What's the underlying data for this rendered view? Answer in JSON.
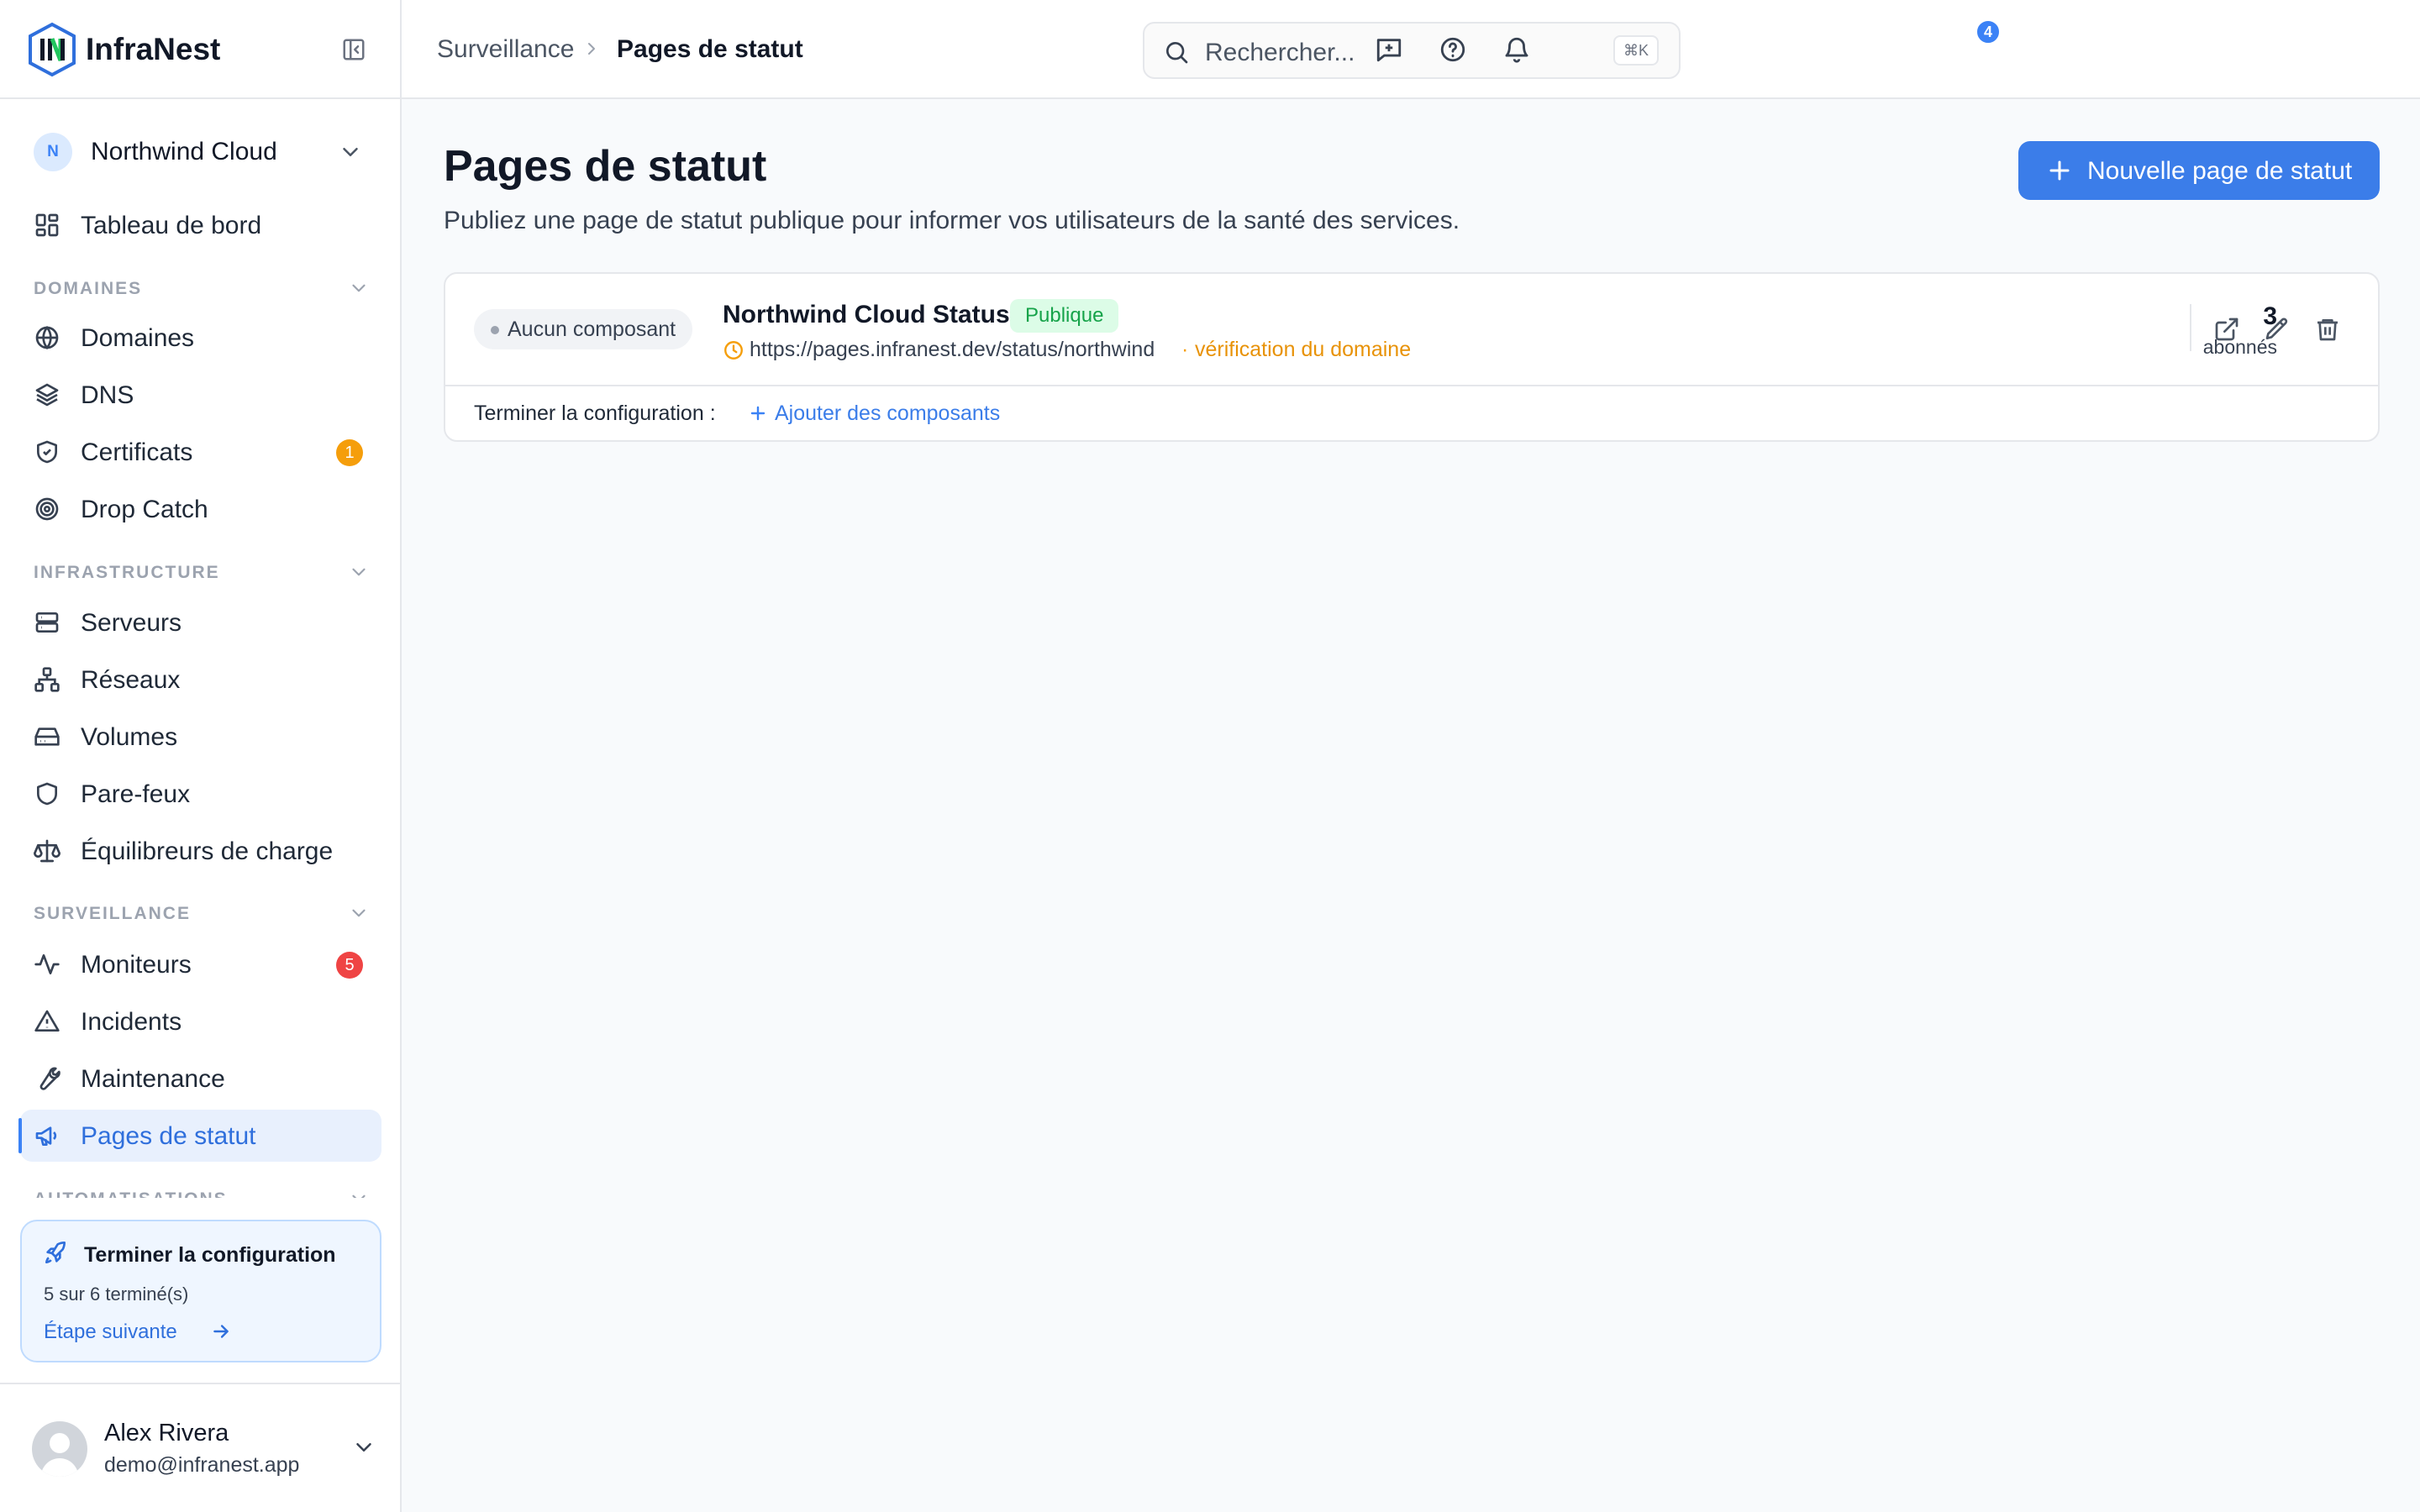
{
  "app": {
    "name": "InfraNest"
  },
  "org": {
    "initial": "N",
    "name": "Northwind Cloud"
  },
  "nav": {
    "top": [
      {
        "label": "Tableau de bord",
        "icon": "dashboard-icon"
      }
    ],
    "sections": [
      {
        "title": "DOMAINES",
        "items": [
          {
            "label": "Domaines",
            "icon": "globe-icon"
          },
          {
            "label": "DNS",
            "icon": "layers-icon"
          },
          {
            "label": "Certificats",
            "icon": "shield-check-icon",
            "badge": "1",
            "badge_color": "#f59e0b"
          },
          {
            "label": "Drop Catch",
            "icon": "target-icon"
          }
        ]
      },
      {
        "title": "INFRASTRUCTURE",
        "items": [
          {
            "label": "Serveurs",
            "icon": "server-icon"
          },
          {
            "label": "Réseaux",
            "icon": "network-icon"
          },
          {
            "label": "Volumes",
            "icon": "hard-drive-icon"
          },
          {
            "label": "Pare-feux",
            "icon": "shield-icon"
          },
          {
            "label": "Équilibreurs de charge",
            "icon": "scale-icon"
          }
        ]
      },
      {
        "title": "SURVEILLANCE",
        "items": [
          {
            "label": "Moniteurs",
            "icon": "activity-icon",
            "badge": "5",
            "badge_color": "#ef4444"
          },
          {
            "label": "Incidents",
            "icon": "alert-triangle-icon"
          },
          {
            "label": "Maintenance",
            "icon": "wrench-icon"
          },
          {
            "label": "Pages de statut",
            "icon": "megaphone-icon",
            "active": true
          }
        ]
      },
      {
        "title": "AUTOMATISATIONS",
        "items": []
      }
    ]
  },
  "setup": {
    "title": "Terminer la configuration",
    "progress": "5 sur 6 terminé(s)",
    "next_label": "Étape suivante"
  },
  "user": {
    "name": "Alex Rivera",
    "email": "demo@infranest.app"
  },
  "topbar": {
    "breadcrumb": [
      "Surveillance",
      "Pages de statut"
    ],
    "search_placeholder": "Rechercher...",
    "search_shortcut": "⌘K",
    "notification_count": "4"
  },
  "main": {
    "title": "Pages de statut",
    "subtitle": "Publiez une page de statut publique pour informer vos utilisateurs de la santé des services.",
    "new_button": "Nouvelle page de statut",
    "status_pages": [
      {
        "components_label": "Aucun composant",
        "name": "Northwind Cloud Status",
        "visibility": "Publique",
        "url": "https://pages.infranest.dev/status/northwind",
        "separator": "·",
        "domain_status": "vérification du domaine",
        "subscribers": "3",
        "subscribers_label": "abonnés",
        "config_label": "Terminer la configuration :",
        "add_components": "Ajouter des composants"
      }
    ]
  },
  "colors": {
    "accent": "#3b82f6",
    "primary_button": "#3b7de9",
    "public_badge_bg": "#dcfce7",
    "public_badge_text": "#16a34a",
    "warning": "#f59e0b"
  }
}
